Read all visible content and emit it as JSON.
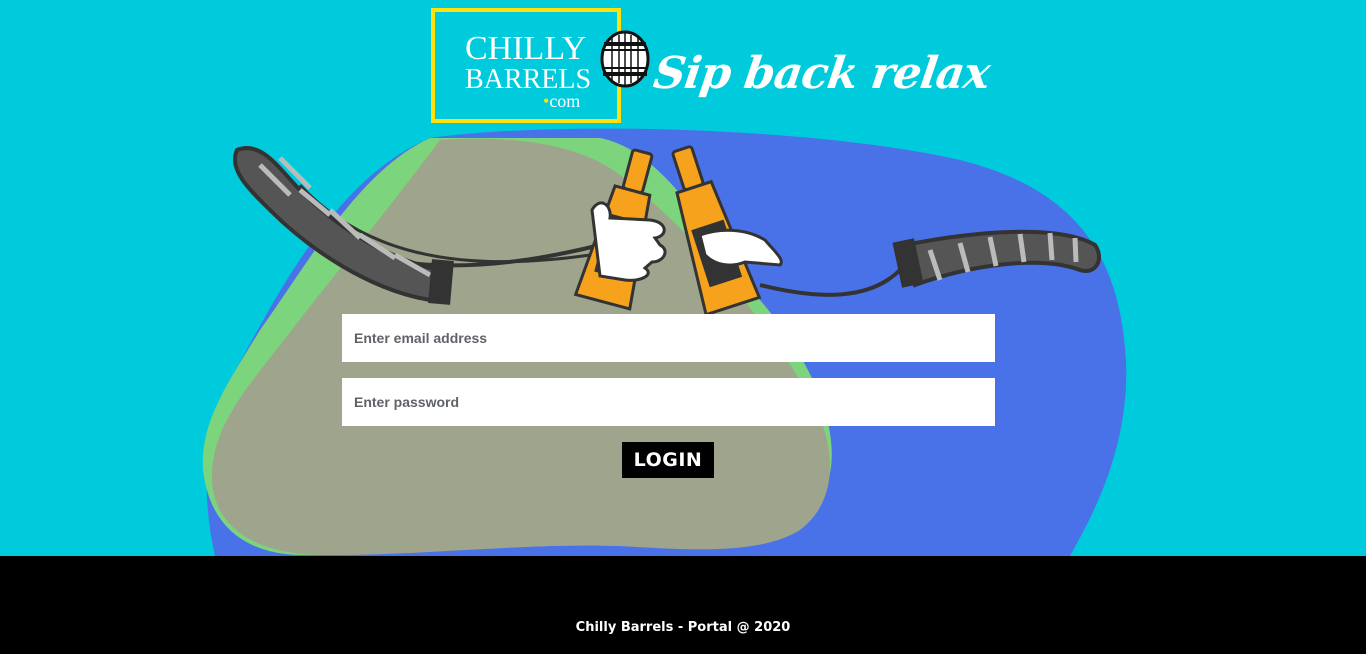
{
  "brand": {
    "line1": "CHILLY",
    "line2": "BARRELS",
    "domain_dot": "•",
    "domain": "com",
    "tagline": "Sip back relax",
    "frame_color": "#ffe10c"
  },
  "colors": {
    "background": "#00cbdc",
    "blob_blue": "#4a72e8",
    "blob_green": "#7cd57d",
    "blob_olive": "#9ea58c",
    "beer": "#f7a21c",
    "footer": "#000000"
  },
  "illustration": {
    "icon": "toasting-beer-bottles-icon",
    "barrel_icon": "barrel-icon"
  },
  "form": {
    "email_placeholder": "Enter email address",
    "password_placeholder": "Enter password",
    "login_label": "LOGIN"
  },
  "footer": {
    "text": "Chilly Barrels - Portal @ 2020"
  }
}
